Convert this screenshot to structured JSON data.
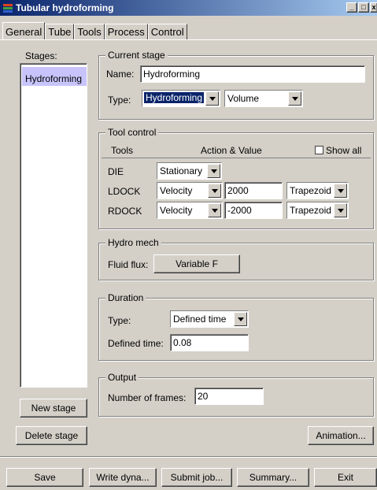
{
  "window": {
    "title": "Tubular hydroforming",
    "minimize": "_",
    "maximize": "□",
    "close": "x"
  },
  "tabs": [
    "General",
    "Tube",
    "Tools",
    "Process",
    "Control"
  ],
  "stages": {
    "label": "Stages:",
    "items": [
      "Hydroforming"
    ],
    "new_button": "New stage",
    "delete_button": "Delete stage"
  },
  "current_stage": {
    "title": "Current stage",
    "name_label": "Name:",
    "name_value": "Hydroforming",
    "type_label": "Type:",
    "type_value": "Hydroforming",
    "subtype_value": "Volume"
  },
  "tool_control": {
    "title": "Tool control",
    "col_tools": "Tools",
    "col_action": "Action & Value",
    "show_all": "Show all",
    "rows": [
      {
        "tool": "DIE",
        "action": "Stationary"
      },
      {
        "tool": "LDOCK",
        "action": "Velocity",
        "value": "2000",
        "curve": "Trapezoid"
      },
      {
        "tool": "RDOCK",
        "action": "Velocity",
        "value": "-2000",
        "curve": "Trapezoid"
      }
    ]
  },
  "hydro_mech": {
    "title": "Hydro mech",
    "flux_label": "Fluid flux:",
    "flux_button": "Variable F"
  },
  "duration": {
    "title": "Duration",
    "type_label": "Type:",
    "type_value": "Defined time",
    "time_label": "Defined time:",
    "time_value": "0.08"
  },
  "output": {
    "title": "Output",
    "frames_label": "Number of frames:",
    "frames_value": "20"
  },
  "animation_button": "Animation...",
  "footer": {
    "save": "Save",
    "write": "Write dyna...",
    "submit": "Submit job...",
    "summary": "Summary...",
    "exit": "Exit"
  }
}
